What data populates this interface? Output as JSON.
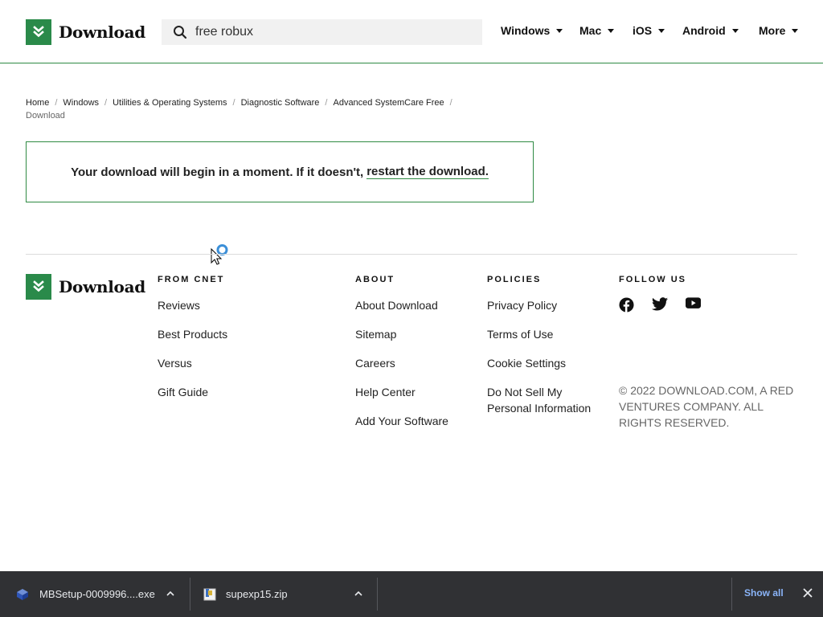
{
  "header": {
    "brand": "Download",
    "search_value": "free robux",
    "nav": [
      "Windows",
      "Mac",
      "iOS",
      "Android",
      "More"
    ]
  },
  "breadcrumb": {
    "items": [
      "Home",
      "Windows",
      "Utilities & Operating Systems",
      "Diagnostic Software",
      "Advanced SystemCare Free"
    ],
    "current": "Download"
  },
  "notice": {
    "text": "Your download will begin in a moment. If it doesn't,",
    "link": "restart the download."
  },
  "footer": {
    "brand": "Download",
    "from_cnet": {
      "heading": "FROM CNET",
      "links": [
        "Reviews",
        "Best Products",
        "Versus",
        "Gift Guide"
      ]
    },
    "about": {
      "heading": "ABOUT",
      "links": [
        "About Download",
        "Sitemap",
        "Careers",
        "Help Center",
        "Add Your Software"
      ]
    },
    "policies": {
      "heading": "POLICIES",
      "links": [
        "Privacy Policy",
        "Terms of Use",
        "Cookie Settings",
        "Do Not Sell My Personal Information"
      ]
    },
    "follow": {
      "heading": "FOLLOW US",
      "icons": [
        "facebook-icon",
        "twitter-icon",
        "youtube-icon"
      ]
    },
    "copyright": "© 2022 DOWNLOAD.COM, A RED VENTURES COMPANY. ALL RIGHTS RESERVED."
  },
  "download_bar": {
    "items": [
      {
        "name": "MBSetup-0009996....exe"
      },
      {
        "name": "supexp15.zip"
      }
    ],
    "show_all": "Show all"
  },
  "colors": {
    "brand_green": "#2a8a4a",
    "download_bar_bg": "#303134",
    "link_blue": "#8ab4f8"
  }
}
